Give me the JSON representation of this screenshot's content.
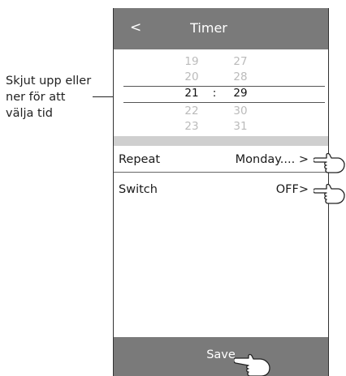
{
  "annotation": {
    "lines": [
      "Skjut upp eller",
      "ner för att",
      "välja tid"
    ]
  },
  "header": {
    "back_label": "<",
    "title": "Timer"
  },
  "time_picker": {
    "rows": [
      {
        "hour": "19",
        "minute": "27",
        "selected": false
      },
      {
        "hour": "20",
        "minute": "28",
        "selected": false
      },
      {
        "hour": "21",
        "minute": "29",
        "selected": true
      },
      {
        "hour": "22",
        "minute": "30",
        "selected": false
      },
      {
        "hour": "23",
        "minute": "31",
        "selected": false
      }
    ],
    "separator": ":"
  },
  "settings": {
    "repeat": {
      "label": "Repeat",
      "value": "Monday.... >"
    },
    "switch": {
      "label": "Switch",
      "value": "OFF>"
    }
  },
  "footer": {
    "save_label": "Save"
  },
  "colors": {
    "bar": "#7a7a7a",
    "band": "#cfcfcf",
    "faded_text": "#bbbbbb"
  },
  "icons": [
    "pointing-hand-icon"
  ]
}
